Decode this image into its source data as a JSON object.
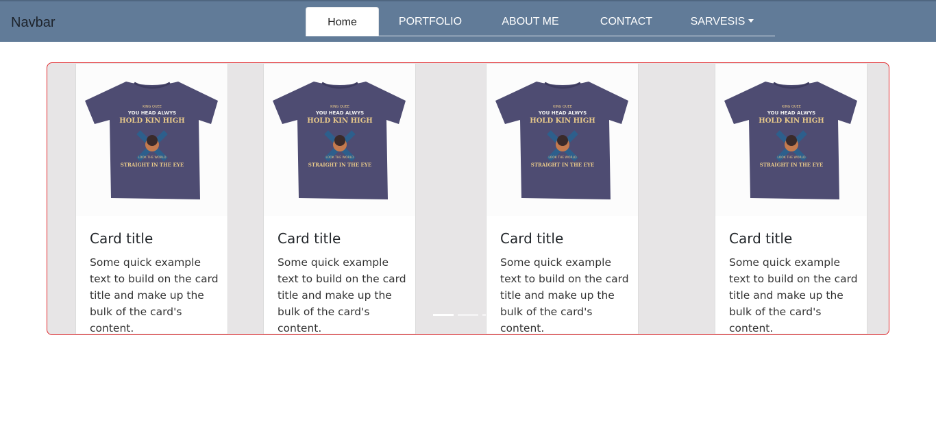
{
  "navbar": {
    "brand": "Navbar",
    "tabs": [
      {
        "label": "Home",
        "active": true
      },
      {
        "label": "PORTFOLIO",
        "active": false
      },
      {
        "label": "ABOUT ME",
        "active": false
      },
      {
        "label": "CONTACT",
        "active": false
      },
      {
        "label": "SARVESIS",
        "active": false,
        "dropdown": true
      }
    ],
    "bg_color": "#617b98"
  },
  "carousel": {
    "border_color": "#e0262a",
    "cards": [
      {
        "image_icon": "tshirt-icon",
        "shirt_text": [
          "KING QUEE",
          "YOU HEAD ALWYS",
          "HOLD KIN HIGH",
          "LOOK THE WORLD",
          "STRAIGHT IN THE EYE"
        ],
        "title": "Card title",
        "text": "Some quick example text to build on the card title and make up the bulk of the card's content."
      },
      {
        "image_icon": "tshirt-icon",
        "shirt_text": [
          "KING QUEE",
          "YOU HEAD ALWYS",
          "HOLD KIN HIGH",
          "LOOK THE WORLD",
          "STRAIGHT IN THE EYE"
        ],
        "title": "Card title",
        "text": "Some quick example text to build on the card title and make up the bulk of the card's content."
      },
      {
        "image_icon": "tshirt-icon",
        "shirt_text": [
          "KING QUEE",
          "YOU HEAD ALWYS",
          "HOLD KIN HIGH",
          "LOOK THE WORLD",
          "STRAIGHT IN THE EYE"
        ],
        "title": "Card title",
        "text": "Some quick example text to build on the card title and make up the bulk of the card's content."
      },
      {
        "image_icon": "tshirt-icon",
        "shirt_text": [
          "KING QUEE",
          "YOU HEAD ALWYS",
          "HOLD KIN HIGH",
          "LOOK THE WORLD",
          "STRAIGHT IN THE EYE"
        ],
        "title": "Card title",
        "text": "Some quick example text to build on the card title and make up the bulk of the card's content."
      }
    ],
    "indicators": [
      {
        "active": true
      },
      {
        "active": false
      },
      {
        "active": false
      }
    ]
  }
}
